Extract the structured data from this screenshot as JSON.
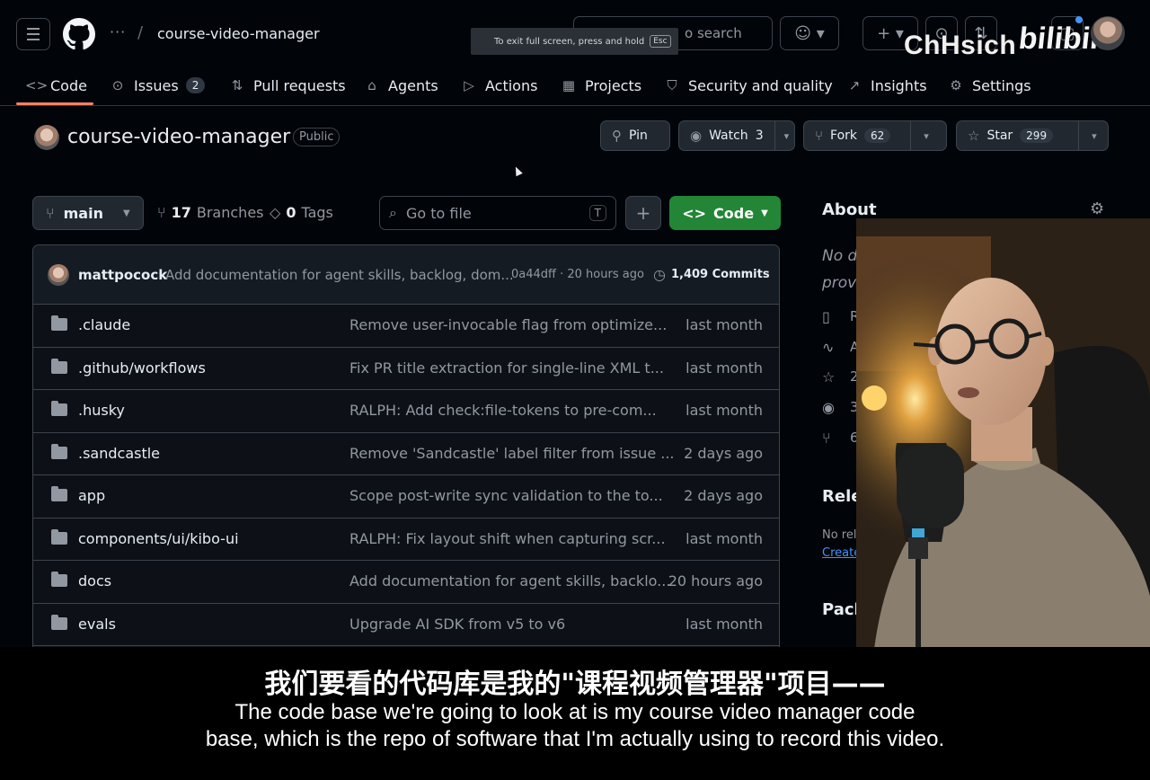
{
  "header": {
    "breadcrumb_dots": "···",
    "breadcrumb_slash": "/",
    "repo_crumb": "course-video-manager",
    "search_placeholder": "o search",
    "fullscreen_tip": "To exit full screen, press and hold",
    "fullscreen_key": "Esc",
    "watermark_name": "ChHsich",
    "watermark_brand": "bilibili"
  },
  "tabs": [
    {
      "label": "Code",
      "icon": "<>"
    },
    {
      "label": "Issues",
      "icon": "⊙",
      "count": "2"
    },
    {
      "label": "Pull requests",
      "icon": "⇅"
    },
    {
      "label": "Agents",
      "icon": "⌂"
    },
    {
      "label": "Actions",
      "icon": "▷"
    },
    {
      "label": "Projects",
      "icon": "▦"
    },
    {
      "label": "Security and quality",
      "icon": "⛉"
    },
    {
      "label": "Insights",
      "icon": "↗"
    },
    {
      "label": "Settings",
      "icon": "⚙"
    }
  ],
  "repo": {
    "name": "course-video-manager",
    "visibility": "Public",
    "pin_label": "Pin",
    "watch_label": "Watch",
    "watch_count": "3",
    "fork_label": "Fork",
    "fork_count": "62",
    "star_label": "Star",
    "star_count": "299"
  },
  "toolbar": {
    "branch": "main",
    "branches_count": "17",
    "branches_label": "Branches",
    "tags_count": "0",
    "tags_label": "Tags",
    "gofile_placeholder": "Go to file",
    "gofile_key": "T",
    "code_label": "Code"
  },
  "latest_commit": {
    "user": "mattpocock",
    "message": "Add documentation for agent skills, backlog, dom...",
    "sha_time": "0a44dff · 20 hours ago",
    "commits": "1,409 Commits"
  },
  "files": [
    {
      "name": ".claude",
      "message": "Remove user-invocable flag from optimize...",
      "date": "last month"
    },
    {
      "name": ".github/workflows",
      "message": "Fix PR title extraction for single-line XML t...",
      "date": "last month"
    },
    {
      "name": ".husky",
      "message": "RALPH: Add check:file-tokens to pre-com...",
      "date": "last month"
    },
    {
      "name": ".sandcastle",
      "message": "Remove 'Sandcastle' label filter from issue ...",
      "date": "2 days ago"
    },
    {
      "name": "app",
      "message": "Scope post-write sync validation to the to...",
      "date": "2 days ago"
    },
    {
      "name": "components/ui/kibo-ui",
      "message": "RALPH: Fix layout shift when capturing scr...",
      "date": "last month"
    },
    {
      "name": "docs",
      "message": "Add documentation for agent skills, backlo...",
      "date": "20 hours ago"
    },
    {
      "name": "evals",
      "message": "Upgrade AI SDK from v5 to v6",
      "date": "last month"
    }
  ],
  "about": {
    "title": "About",
    "desc_line1": "No d",
    "desc_line2": "prov",
    "stats": [
      "R",
      "A",
      "2",
      "3",
      "6"
    ],
    "releases_title": "Rele",
    "releases_none": "No rel",
    "releases_link": "Create",
    "packages_title": "Pack"
  },
  "subtitles": {
    "chinese": "我们要看的代码库是我的\"课程视频管理器\"项目——",
    "english_line1": "The code base we're going to look at is my course video manager code",
    "english_line2": "base, which is the repo of software that I'm actually using to record this video."
  },
  "colors": {
    "background": "#010409",
    "accent_underline": "#f78166",
    "code_button": "#238636",
    "link": "#4493f8"
  }
}
